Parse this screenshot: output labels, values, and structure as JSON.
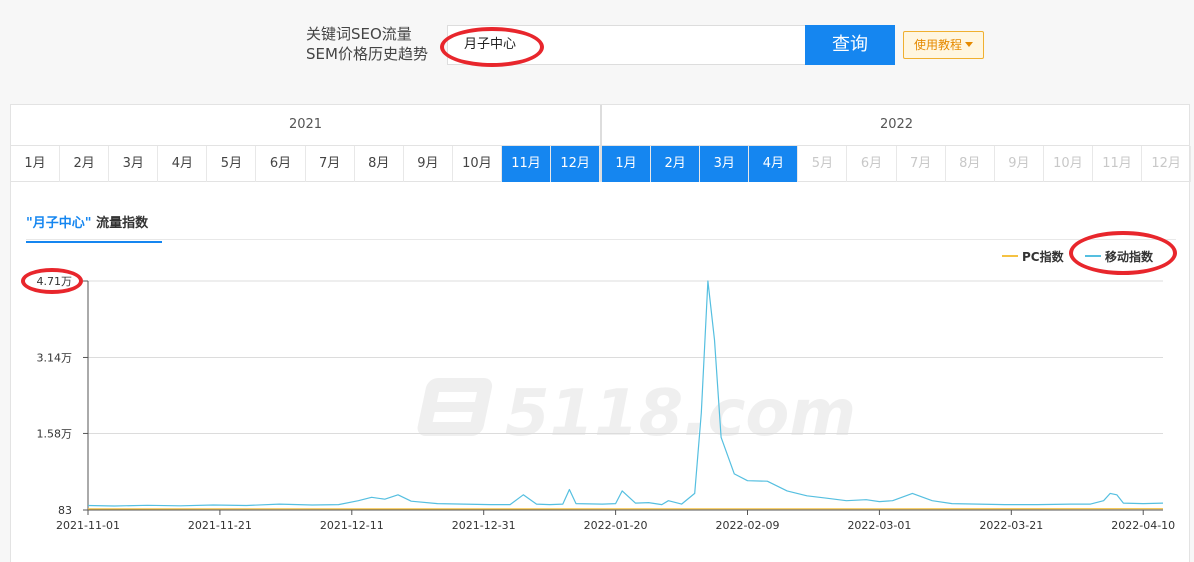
{
  "search": {
    "label_line1": "关键词SEO流量",
    "label_line2": "SEM价格历史趋势",
    "value": "月子中心",
    "button": "查询",
    "help": "使用教程"
  },
  "years": [
    "2021",
    "2022"
  ],
  "months_2021": [
    "1月",
    "2月",
    "3月",
    "4月",
    "5月",
    "6月",
    "7月",
    "8月",
    "9月",
    "10月",
    "11月",
    "12月"
  ],
  "months_2022": [
    "1月",
    "2月",
    "3月",
    "4月",
    "5月",
    "6月",
    "7月",
    "8月",
    "9月",
    "10月",
    "11月",
    "12月"
  ],
  "tab": {
    "keyword": "\"月子中心\"",
    "title": "流量指数"
  },
  "watermark": "5118.com",
  "colors": {
    "accent": "#1586f0",
    "pc": "#f5c242",
    "mobile": "#55bfe0",
    "highlight": "#e8262c"
  },
  "chart_data": {
    "type": "line",
    "title": "",
    "xlabel": "",
    "ylabel": "",
    "ylim": [
      83,
      47100
    ],
    "y_ticks": [
      83,
      15800,
      31400,
      47100
    ],
    "y_tick_labels": [
      "83",
      "1.58万",
      "3.14万",
      "4.71万"
    ],
    "x_tick_labels": [
      "2021-11-01",
      "2021-11-21",
      "2021-12-11",
      "2021-12-31",
      "2022-01-20",
      "2022-02-09",
      "2022-03-01",
      "2022-03-21",
      "2022-04-10"
    ],
    "x_start": "2021-11-01",
    "x_end": "2022-04-13",
    "grid": true,
    "legend_position": "top-right",
    "series": [
      {
        "name": "PC指数",
        "color": "#f5c242",
        "points": [
          [
            "2021-11-01",
            300
          ],
          [
            "2021-12-01",
            320
          ],
          [
            "2022-01-01",
            310
          ],
          [
            "2022-02-01",
            330
          ],
          [
            "2022-03-01",
            320
          ],
          [
            "2022-04-13",
            350
          ]
        ]
      },
      {
        "name": "移动指数",
        "color": "#55bfe0",
        "points": [
          [
            "2021-11-01",
            1000
          ],
          [
            "2021-11-05",
            900
          ],
          [
            "2021-11-10",
            1050
          ],
          [
            "2021-11-15",
            950
          ],
          [
            "2021-11-20",
            1100
          ],
          [
            "2021-11-25",
            1000
          ],
          [
            "2021-11-30",
            1300
          ],
          [
            "2021-12-05",
            1100
          ],
          [
            "2021-12-09",
            1200
          ],
          [
            "2021-12-12",
            2000
          ],
          [
            "2021-12-14",
            2700
          ],
          [
            "2021-12-16",
            2300
          ],
          [
            "2021-12-18",
            3200
          ],
          [
            "2021-12-20",
            1900
          ],
          [
            "2021-12-24",
            1400
          ],
          [
            "2021-12-28",
            1300
          ],
          [
            "2022-01-01",
            1200
          ],
          [
            "2022-01-04",
            1200
          ],
          [
            "2022-01-06",
            3200
          ],
          [
            "2022-01-08",
            1300
          ],
          [
            "2022-01-10",
            1200
          ],
          [
            "2022-01-12",
            1300
          ],
          [
            "2022-01-13",
            4300
          ],
          [
            "2022-01-14",
            1400
          ],
          [
            "2022-01-18",
            1300
          ],
          [
            "2022-01-20",
            1400
          ],
          [
            "2022-01-21",
            4000
          ],
          [
            "2022-01-23",
            1500
          ],
          [
            "2022-01-25",
            1600
          ],
          [
            "2022-01-27",
            1200
          ],
          [
            "2022-01-28",
            2000
          ],
          [
            "2022-01-30",
            1300
          ],
          [
            "2022-02-01",
            3500
          ],
          [
            "2022-02-02",
            20000
          ],
          [
            "2022-02-03",
            47100
          ],
          [
            "2022-02-04",
            35000
          ],
          [
            "2022-02-05",
            15000
          ],
          [
            "2022-02-07",
            7500
          ],
          [
            "2022-02-09",
            6100
          ],
          [
            "2022-02-12",
            6000
          ],
          [
            "2022-02-15",
            4000
          ],
          [
            "2022-02-18",
            3000
          ],
          [
            "2022-02-21",
            2500
          ],
          [
            "2022-02-24",
            2000
          ],
          [
            "2022-02-27",
            2200
          ],
          [
            "2022-03-01",
            1800
          ],
          [
            "2022-03-03",
            2000
          ],
          [
            "2022-03-06",
            3500
          ],
          [
            "2022-03-09",
            2000
          ],
          [
            "2022-03-12",
            1400
          ],
          [
            "2022-03-16",
            1300
          ],
          [
            "2022-03-20",
            1200
          ],
          [
            "2022-03-25",
            1200
          ],
          [
            "2022-03-30",
            1300
          ],
          [
            "2022-04-02",
            1300
          ],
          [
            "2022-04-04",
            2000
          ],
          [
            "2022-04-05",
            3500
          ],
          [
            "2022-04-06",
            3200
          ],
          [
            "2022-04-07",
            1500
          ],
          [
            "2022-04-10",
            1400
          ],
          [
            "2022-04-13",
            1500
          ]
        ]
      }
    ]
  }
}
